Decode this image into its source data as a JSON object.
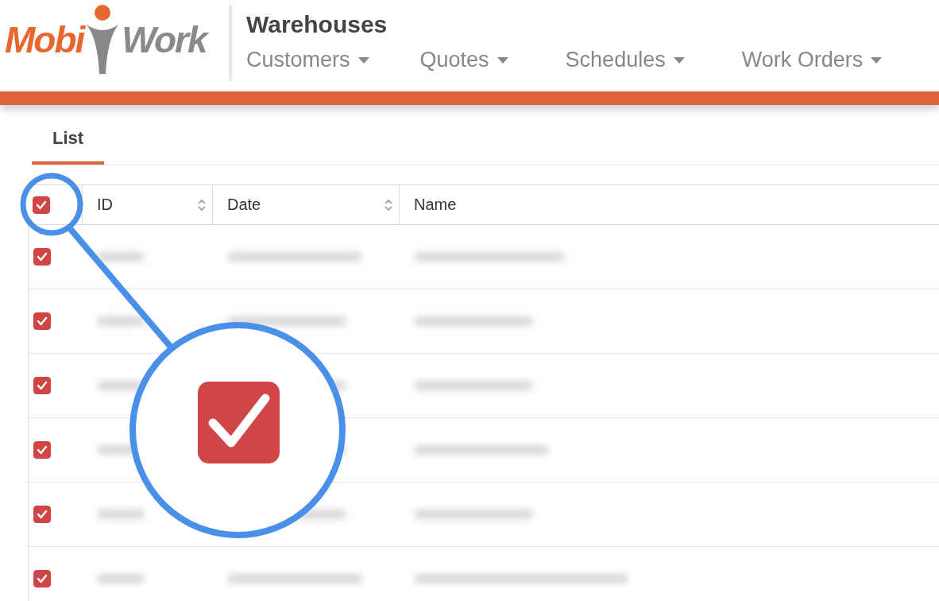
{
  "logo": {
    "parts": [
      "Mobi",
      "Work"
    ]
  },
  "header": {
    "title": "Warehouses"
  },
  "nav": [
    {
      "label": "Customers"
    },
    {
      "label": "Quotes"
    },
    {
      "label": "Schedules"
    },
    {
      "label": "Work Orders"
    }
  ],
  "tabs": [
    {
      "label": "List",
      "selected": true
    }
  ],
  "table": {
    "select_all": {
      "checked": true
    },
    "columns": [
      {
        "label": "ID",
        "sortable": true
      },
      {
        "label": "Date",
        "sortable": true
      },
      {
        "label": "Name",
        "sortable": false
      }
    ],
    "rows": [
      {
        "checked": true
      },
      {
        "checked": true
      },
      {
        "checked": true
      },
      {
        "checked": true
      },
      {
        "checked": true
      },
      {
        "checked": true
      }
    ]
  }
}
